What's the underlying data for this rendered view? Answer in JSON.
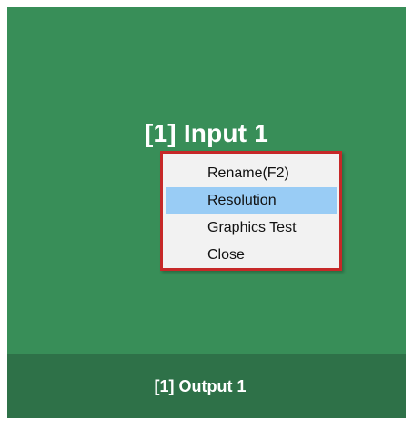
{
  "panel": {
    "input_title": "[1] Input 1",
    "output_label": "[1] Output 1"
  },
  "context_menu": {
    "items": [
      {
        "label": "Rename(F2)",
        "selected": false
      },
      {
        "label": "Resolution",
        "selected": true
      },
      {
        "label": "Graphics Test",
        "selected": false
      },
      {
        "label": "Close",
        "selected": false
      }
    ]
  },
  "colors": {
    "panel_green": "#388e58",
    "output_bar_green": "#2e7148",
    "menu_border_red": "#c62828",
    "menu_highlight_blue": "#99ccf5"
  }
}
